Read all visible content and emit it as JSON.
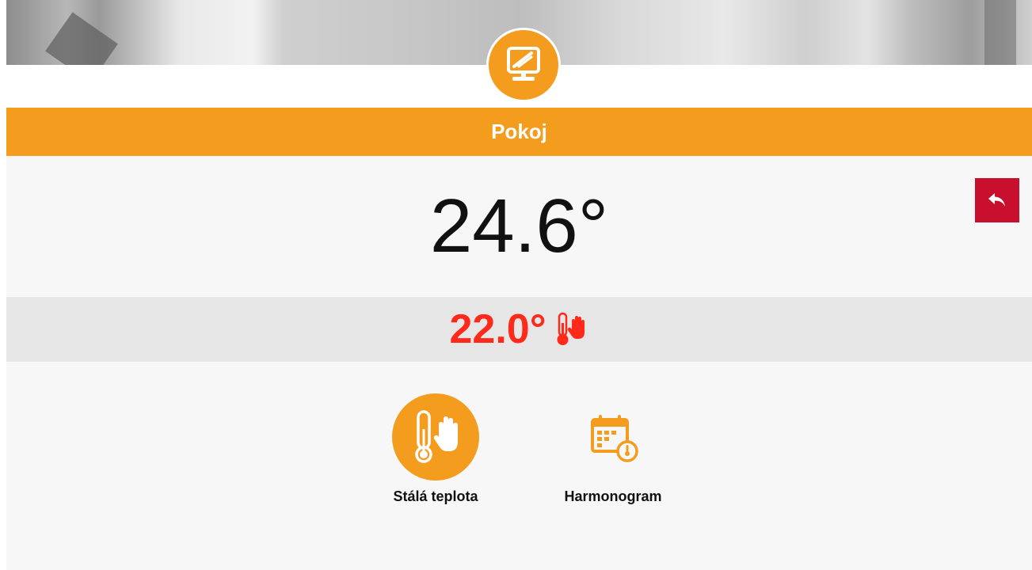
{
  "header": {
    "room_title": "Pokoj"
  },
  "temperature": {
    "current": "24.6°",
    "setpoint": "22.0°"
  },
  "modes": [
    {
      "label": "Stálá teplota",
      "icon": "thermometer-hand-icon",
      "active": true
    },
    {
      "label": "Harmonogram",
      "icon": "calendar-thermometer-icon",
      "active": false
    }
  ],
  "icons": {
    "device": "monitor-icon",
    "back": "back-arrow-icon",
    "setpoint_mode": "thermometer-hand-icon"
  },
  "colors": {
    "accent": "#f39c1e",
    "back_button": "#c8102e",
    "setpoint": "#ff2a1a"
  }
}
